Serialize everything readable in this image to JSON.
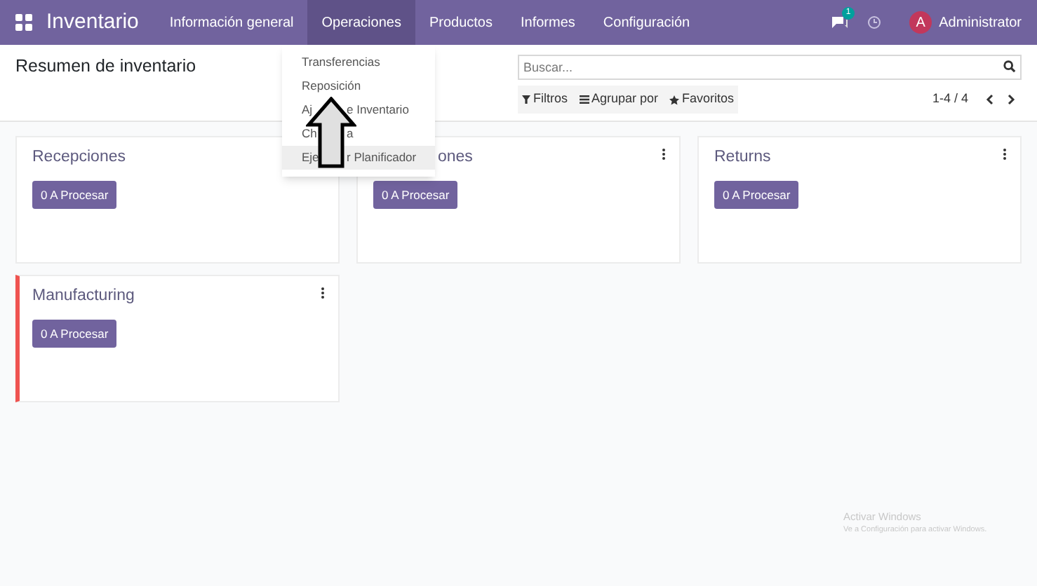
{
  "navbar": {
    "app_title": "Inventario",
    "menus": [
      {
        "label": "Información general",
        "selected": false
      },
      {
        "label": "Operaciones",
        "selected": true
      },
      {
        "label": "Productos",
        "selected": false
      },
      {
        "label": "Informes",
        "selected": false
      },
      {
        "label": "Configuración",
        "selected": false
      }
    ],
    "chat_badge": "1",
    "user": {
      "initial": "A",
      "name": "Administrator"
    }
  },
  "dropdown": {
    "items": [
      {
        "parts": [
          "Transferencias"
        ],
        "highlighted": false
      },
      {
        "parts": [
          "Reposición"
        ],
        "highlighted": false
      },
      {
        "parts": [
          "Aj",
          "e Inventario"
        ],
        "highlighted": false
      },
      {
        "parts": [
          "Ch",
          "a"
        ],
        "highlighted": false
      },
      {
        "parts": [
          "Eje",
          "r Planificador"
        ],
        "highlighted": true
      }
    ]
  },
  "control_panel": {
    "breadcrumb": "Resumen de inventario",
    "search": {
      "placeholder": "Buscar..."
    },
    "filters": [
      {
        "kind": "filter",
        "label": "Filtros"
      },
      {
        "kind": "group",
        "label": "Agrupar por"
      },
      {
        "kind": "favorite",
        "label": "Favoritos"
      }
    ],
    "pager": "1-4 / 4"
  },
  "cards": [
    {
      "title": "Recepciones",
      "flagged": false,
      "button": "0 A Procesar"
    },
    {
      "title": "ones",
      "partial": true,
      "menu": true,
      "flagged": false,
      "button": "0 A Procesar"
    },
    {
      "title": "Returns",
      "menu": true,
      "flagged": false,
      "button": "0 A Procesar"
    },
    {
      "title": "Manufacturing",
      "menu": true,
      "flagged": true,
      "button": "0 A Procesar"
    }
  ],
  "watermark": {
    "title": "Activar Windows",
    "subtitle": "Ve a Configuración para activar Windows."
  }
}
